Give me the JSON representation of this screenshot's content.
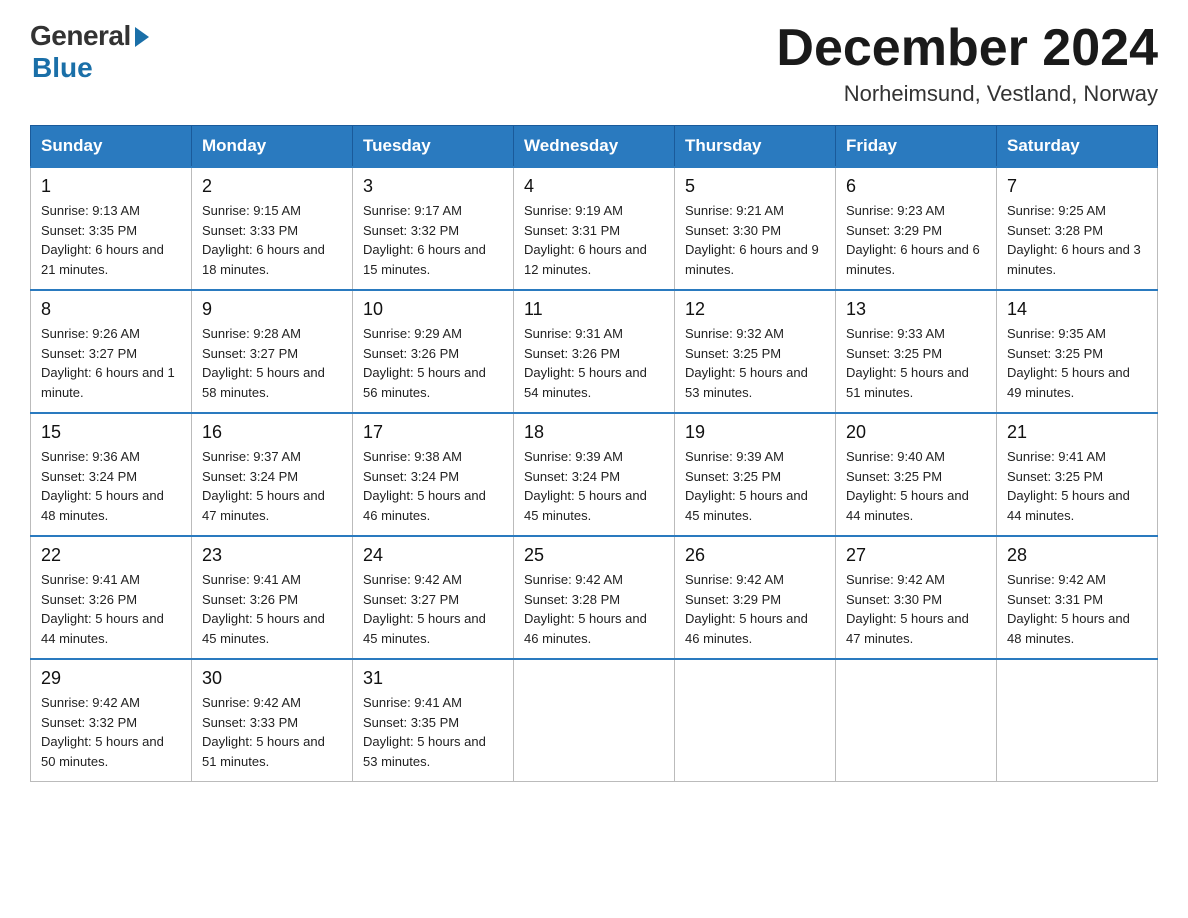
{
  "header": {
    "logo_general": "General",
    "logo_blue": "Blue",
    "month_title": "December 2024",
    "subtitle": "Norheimsund, Vestland, Norway"
  },
  "calendar": {
    "days_of_week": [
      "Sunday",
      "Monday",
      "Tuesday",
      "Wednesday",
      "Thursday",
      "Friday",
      "Saturday"
    ],
    "weeks": [
      [
        {
          "day": "1",
          "sunrise": "Sunrise: 9:13 AM",
          "sunset": "Sunset: 3:35 PM",
          "daylight": "Daylight: 6 hours and 21 minutes."
        },
        {
          "day": "2",
          "sunrise": "Sunrise: 9:15 AM",
          "sunset": "Sunset: 3:33 PM",
          "daylight": "Daylight: 6 hours and 18 minutes."
        },
        {
          "day": "3",
          "sunrise": "Sunrise: 9:17 AM",
          "sunset": "Sunset: 3:32 PM",
          "daylight": "Daylight: 6 hours and 15 minutes."
        },
        {
          "day": "4",
          "sunrise": "Sunrise: 9:19 AM",
          "sunset": "Sunset: 3:31 PM",
          "daylight": "Daylight: 6 hours and 12 minutes."
        },
        {
          "day": "5",
          "sunrise": "Sunrise: 9:21 AM",
          "sunset": "Sunset: 3:30 PM",
          "daylight": "Daylight: 6 hours and 9 minutes."
        },
        {
          "day": "6",
          "sunrise": "Sunrise: 9:23 AM",
          "sunset": "Sunset: 3:29 PM",
          "daylight": "Daylight: 6 hours and 6 minutes."
        },
        {
          "day": "7",
          "sunrise": "Sunrise: 9:25 AM",
          "sunset": "Sunset: 3:28 PM",
          "daylight": "Daylight: 6 hours and 3 minutes."
        }
      ],
      [
        {
          "day": "8",
          "sunrise": "Sunrise: 9:26 AM",
          "sunset": "Sunset: 3:27 PM",
          "daylight": "Daylight: 6 hours and 1 minute."
        },
        {
          "day": "9",
          "sunrise": "Sunrise: 9:28 AM",
          "sunset": "Sunset: 3:27 PM",
          "daylight": "Daylight: 5 hours and 58 minutes."
        },
        {
          "day": "10",
          "sunrise": "Sunrise: 9:29 AM",
          "sunset": "Sunset: 3:26 PM",
          "daylight": "Daylight: 5 hours and 56 minutes."
        },
        {
          "day": "11",
          "sunrise": "Sunrise: 9:31 AM",
          "sunset": "Sunset: 3:26 PM",
          "daylight": "Daylight: 5 hours and 54 minutes."
        },
        {
          "day": "12",
          "sunrise": "Sunrise: 9:32 AM",
          "sunset": "Sunset: 3:25 PM",
          "daylight": "Daylight: 5 hours and 53 minutes."
        },
        {
          "day": "13",
          "sunrise": "Sunrise: 9:33 AM",
          "sunset": "Sunset: 3:25 PM",
          "daylight": "Daylight: 5 hours and 51 minutes."
        },
        {
          "day": "14",
          "sunrise": "Sunrise: 9:35 AM",
          "sunset": "Sunset: 3:25 PM",
          "daylight": "Daylight: 5 hours and 49 minutes."
        }
      ],
      [
        {
          "day": "15",
          "sunrise": "Sunrise: 9:36 AM",
          "sunset": "Sunset: 3:24 PM",
          "daylight": "Daylight: 5 hours and 48 minutes."
        },
        {
          "day": "16",
          "sunrise": "Sunrise: 9:37 AM",
          "sunset": "Sunset: 3:24 PM",
          "daylight": "Daylight: 5 hours and 47 minutes."
        },
        {
          "day": "17",
          "sunrise": "Sunrise: 9:38 AM",
          "sunset": "Sunset: 3:24 PM",
          "daylight": "Daylight: 5 hours and 46 minutes."
        },
        {
          "day": "18",
          "sunrise": "Sunrise: 9:39 AM",
          "sunset": "Sunset: 3:24 PM",
          "daylight": "Daylight: 5 hours and 45 minutes."
        },
        {
          "day": "19",
          "sunrise": "Sunrise: 9:39 AM",
          "sunset": "Sunset: 3:25 PM",
          "daylight": "Daylight: 5 hours and 45 minutes."
        },
        {
          "day": "20",
          "sunrise": "Sunrise: 9:40 AM",
          "sunset": "Sunset: 3:25 PM",
          "daylight": "Daylight: 5 hours and 44 minutes."
        },
        {
          "day": "21",
          "sunrise": "Sunrise: 9:41 AM",
          "sunset": "Sunset: 3:25 PM",
          "daylight": "Daylight: 5 hours and 44 minutes."
        }
      ],
      [
        {
          "day": "22",
          "sunrise": "Sunrise: 9:41 AM",
          "sunset": "Sunset: 3:26 PM",
          "daylight": "Daylight: 5 hours and 44 minutes."
        },
        {
          "day": "23",
          "sunrise": "Sunrise: 9:41 AM",
          "sunset": "Sunset: 3:26 PM",
          "daylight": "Daylight: 5 hours and 45 minutes."
        },
        {
          "day": "24",
          "sunrise": "Sunrise: 9:42 AM",
          "sunset": "Sunset: 3:27 PM",
          "daylight": "Daylight: 5 hours and 45 minutes."
        },
        {
          "day": "25",
          "sunrise": "Sunrise: 9:42 AM",
          "sunset": "Sunset: 3:28 PM",
          "daylight": "Daylight: 5 hours and 46 minutes."
        },
        {
          "day": "26",
          "sunrise": "Sunrise: 9:42 AM",
          "sunset": "Sunset: 3:29 PM",
          "daylight": "Daylight: 5 hours and 46 minutes."
        },
        {
          "day": "27",
          "sunrise": "Sunrise: 9:42 AM",
          "sunset": "Sunset: 3:30 PM",
          "daylight": "Daylight: 5 hours and 47 minutes."
        },
        {
          "day": "28",
          "sunrise": "Sunrise: 9:42 AM",
          "sunset": "Sunset: 3:31 PM",
          "daylight": "Daylight: 5 hours and 48 minutes."
        }
      ],
      [
        {
          "day": "29",
          "sunrise": "Sunrise: 9:42 AM",
          "sunset": "Sunset: 3:32 PM",
          "daylight": "Daylight: 5 hours and 50 minutes."
        },
        {
          "day": "30",
          "sunrise": "Sunrise: 9:42 AM",
          "sunset": "Sunset: 3:33 PM",
          "daylight": "Daylight: 5 hours and 51 minutes."
        },
        {
          "day": "31",
          "sunrise": "Sunrise: 9:41 AM",
          "sunset": "Sunset: 3:35 PM",
          "daylight": "Daylight: 5 hours and 53 minutes."
        },
        null,
        null,
        null,
        null
      ]
    ]
  }
}
